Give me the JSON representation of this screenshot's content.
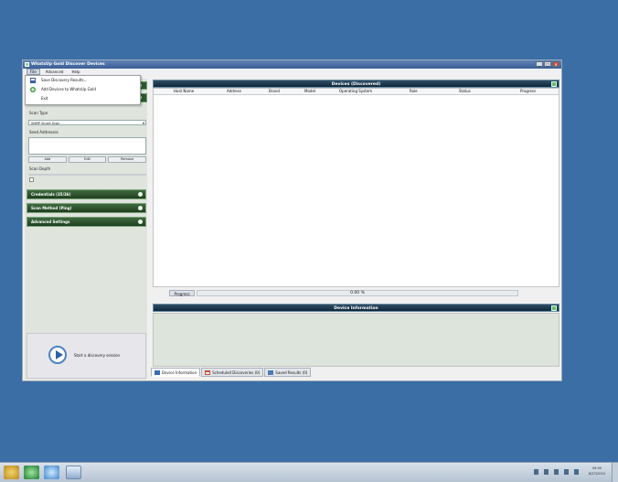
{
  "window": {
    "title": "WhatsUp Gold Discover Devices"
  },
  "menubar": {
    "items": [
      "File",
      "Advanced",
      "Help"
    ]
  },
  "file_menu": {
    "items": [
      "Save Discovery Results...",
      "Add Devices to WhatsUp Gold",
      "Exit"
    ]
  },
  "left_panel": {
    "scan_type_label": "Scan Type",
    "scan_type_value": "SNMP Smart Scan",
    "seed_label": "Seed Addresses",
    "add_label": "Add",
    "edit_label": "Edit",
    "remove_label": "Remove",
    "scan_depth_label": "Scan Depth",
    "sections": [
      "Credentials (35/36)",
      "Scan Method (Ping)",
      "Advanced Settings"
    ],
    "start_label": "Start a discovery session"
  },
  "devices": {
    "title": "Devices (Discovered)",
    "columns": [
      "Host Name",
      "Address",
      "Brand",
      "Model",
      "Operating System",
      "Role",
      "Status",
      "Progress"
    ]
  },
  "progress": {
    "label": "Progress",
    "text": "0.00 %",
    "fraction": 0
  },
  "device_info": {
    "title": "Device Information"
  },
  "tabs": [
    "Device Information",
    "Scheduled Discoveries (0)",
    "Saved Results (0)"
  ],
  "taskbar": {
    "clock_time": "09:00",
    "clock_date": "8/27/2010"
  },
  "colors": {
    "desktop": "#3a6ea5",
    "section_green": "#2d5a2d",
    "header_dark": "#10263a"
  }
}
